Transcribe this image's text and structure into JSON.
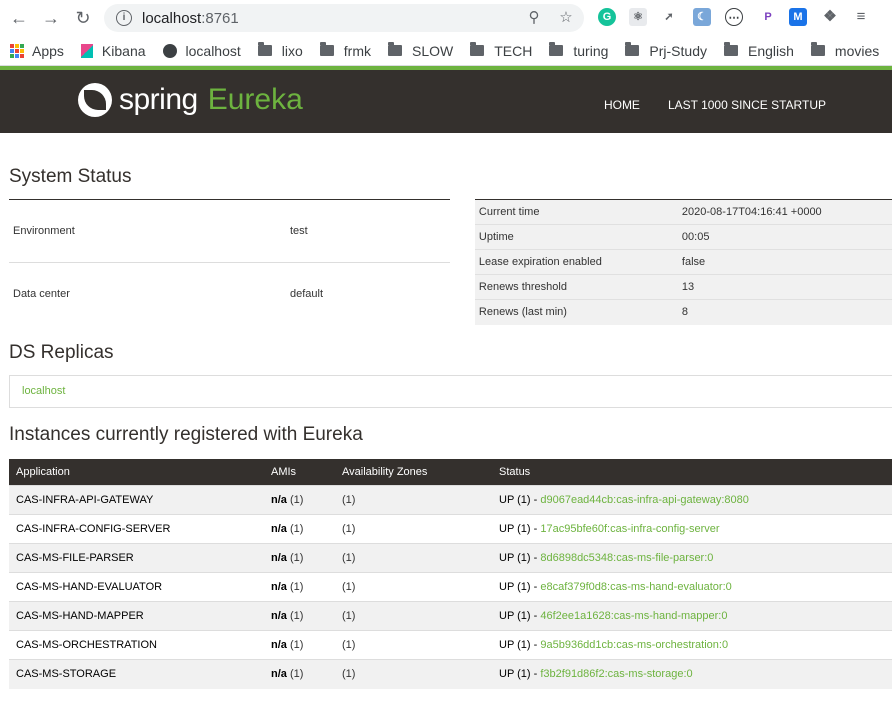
{
  "browser": {
    "url_host": "localhost",
    "url_port": ":8761",
    "bookmarks": [
      "Apps",
      "Kibana",
      "localhost",
      "lixo",
      "frmk",
      "SLOW",
      "TECH",
      "turing",
      "Prj-Study",
      "English",
      "movies"
    ]
  },
  "header": {
    "logo_spring": "spring",
    "logo_eureka": "Eureka",
    "nav": [
      "HOME",
      "LAST 1000 SINCE STARTUP"
    ]
  },
  "system_status": {
    "title": "System Status",
    "left": [
      {
        "k": "Environment",
        "v": "test"
      },
      {
        "k": "Data center",
        "v": "default"
      }
    ],
    "right": [
      {
        "k": "Current time",
        "v": "2020-08-17T04:16:41 +0000"
      },
      {
        "k": "Uptime",
        "v": "00:05"
      },
      {
        "k": "Lease expiration enabled",
        "v": "false"
      },
      {
        "k": "Renews threshold",
        "v": "13"
      },
      {
        "k": "Renews (last min)",
        "v": "8"
      }
    ]
  },
  "replicas": {
    "title": "DS Replicas",
    "items": [
      "localhost"
    ]
  },
  "instances": {
    "title": "Instances currently registered with Eureka",
    "columns": [
      "Application",
      "AMIs",
      "Availability Zones",
      "Status"
    ],
    "rows": [
      {
        "app": "CAS-INFRA-API-GATEWAY",
        "ami": "n/a",
        "ami_count": "(1)",
        "zones": "(1)",
        "status": "UP (1) - ",
        "instance": "d9067ead44cb:cas-infra-api-gateway:8080"
      },
      {
        "app": "CAS-INFRA-CONFIG-SERVER",
        "ami": "n/a",
        "ami_count": "(1)",
        "zones": "(1)",
        "status": "UP (1) - ",
        "instance": "17ac95bfe60f:cas-infra-config-server"
      },
      {
        "app": "CAS-MS-FILE-PARSER",
        "ami": "n/a",
        "ami_count": "(1)",
        "zones": "(1)",
        "status": "UP (1) - ",
        "instance": "8d6898dc5348:cas-ms-file-parser:0"
      },
      {
        "app": "CAS-MS-HAND-EVALUATOR",
        "ami": "n/a",
        "ami_count": "(1)",
        "zones": "(1)",
        "status": "UP (1) - ",
        "instance": "e8caf379f0d8:cas-ms-hand-evaluator:0"
      },
      {
        "app": "CAS-MS-HAND-MAPPER",
        "ami": "n/a",
        "ami_count": "(1)",
        "zones": "(1)",
        "status": "UP (1) - ",
        "instance": "46f2ee1a1628:cas-ms-hand-mapper:0"
      },
      {
        "app": "CAS-MS-ORCHESTRATION",
        "ami": "n/a",
        "ami_count": "(1)",
        "zones": "(1)",
        "status": "UP (1) - ",
        "instance": "9a5b936dd1cb:cas-ms-orchestration:0"
      },
      {
        "app": "CAS-MS-STORAGE",
        "ami": "n/a",
        "ami_count": "(1)",
        "zones": "(1)",
        "status": "UP (1) - ",
        "instance": "f3b2f91d86f2:cas-ms-storage:0"
      }
    ]
  },
  "colors": {
    "brand_green": "#6db33f",
    "header_dark": "#34302d"
  }
}
